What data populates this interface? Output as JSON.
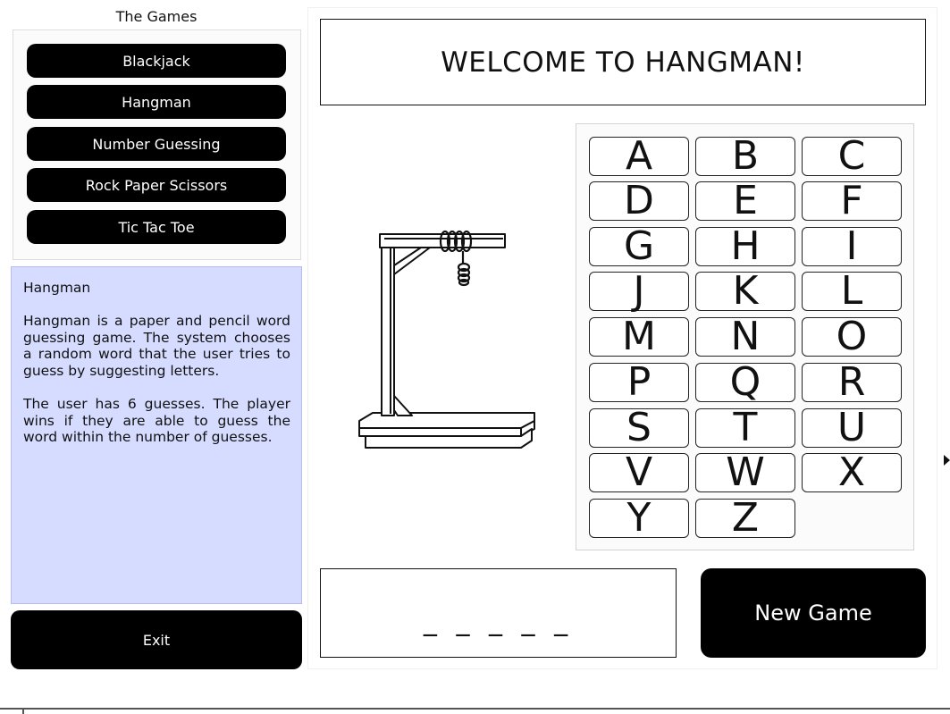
{
  "sidebar": {
    "title": "The Games",
    "games": [
      "Blackjack",
      "Hangman",
      "Number Guessing",
      "Rock Paper Scissors",
      "Tic Tac Toe"
    ],
    "exit_label": "Exit"
  },
  "description": {
    "title": "Hangman",
    "paragraph1": "Hangman is a paper and pencil word guessing game. The system chooses a random word that the user tries to guess by suggesting letters.",
    "paragraph2": "The user has 6 guesses. The player wins if they are able to guess the word within the number of guesses."
  },
  "main": {
    "welcome": "WELCOME TO HANGMAN!",
    "letters": [
      "A",
      "B",
      "C",
      "D",
      "E",
      "F",
      "G",
      "H",
      "I",
      "J",
      "K",
      "L",
      "M",
      "N",
      "O",
      "P",
      "Q",
      "R",
      "S",
      "T",
      "U",
      "V",
      "W",
      "X",
      "Y",
      "Z"
    ],
    "word_display": "_ _ _ _ _",
    "new_game_label": "New Game"
  },
  "colors": {
    "button_bg": "#000000",
    "description_bg": "#d6dcff"
  },
  "icons": {
    "gallows": "gallows-illustration"
  }
}
